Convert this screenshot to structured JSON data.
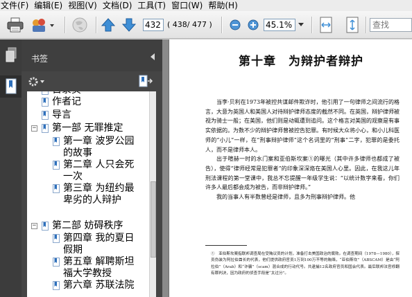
{
  "menu": [
    "文件(F)",
    "编辑(E)",
    "视图(V)",
    "文档(D)",
    "工具(T)",
    "窗口(W)",
    "帮助(H)"
  ],
  "toolbar": {
    "page_number": "432",
    "page_count": "( 438/ 477 )",
    "zoom": "45.1%",
    "search_placeholder": "查找"
  },
  "panel": {
    "title": "书签"
  },
  "bookmarks": [
    {
      "label": "日录页",
      "level": 0
    },
    {
      "label": "作者记",
      "level": 0
    },
    {
      "label": "导言",
      "level": 0
    },
    {
      "label": "第一部 无罪推定",
      "level": 0,
      "toggle": "−"
    },
    {
      "label": "第一章 波罗公园的故事",
      "level": 1
    },
    {
      "label": "第二章 人只会死一次",
      "level": 1
    },
    {
      "label": "第三章 为纽约最卑劣的人辩护",
      "level": 1
    },
    {
      "label": "第二部 妨碍秩序",
      "level": 0,
      "toggle": "−"
    },
    {
      "label": "第四章 我的夏日假期",
      "level": 1
    },
    {
      "label": "第五章 解聘斯坦福大学教授",
      "level": 1
    },
    {
      "label": "第六章 苏联法院",
      "level": 1
    }
  ],
  "document": {
    "chapter_title": "第十章　为辩护者辩护",
    "paragraphs": [
      "当李·贝利在1973年被控共谋邮件欺诈时，他引用了一句律师之间流行的格言，大意为英国人和美国人对待辩护律师态度的截然不同。在英国，辩护律师被视为骑士一般；在美国，他们则是动辄遭到追问。这个格言对美国的观察是有事实依据的。为数不少的辩护律师曾被控告犯罪。有时候大众将小心，和小儿科医师的“小儿”一样，在“刑事辩护律师”这个名词里的“刑事”二字，犯罪的是委托人，而不是律师本人。",
      "出于暄赫一时的水门案和亚伯斯坎案①的曝光（其中许多律师也都成了被告），使得“律师经常是犯罪者”的印象深深烙在美国人心里。因此，在我这儿年刑法课程的第一堂课中，我总不忘提醒一年级学生说：“以统计数字来看，你们许多人最后都会成为被告，而非辩护律师。”",
      "我的当事人有半数曾经是律师，且多为刑事辩护律师。他"
    ],
    "footnote": "①　亚伯斯坎案指联邦调查局在受贿议员的计划，准备打击美国政治的腐败。在调查期间（1978—1980），探员伪装为阿拉伯酋长的代表，他们提供政府官员1万到100万不等的贿赂，“亚伯斯坎”（ABSCAM）是由“阿拉伯”（Arab）和“诈骗”（scam）混合成的行动代号。共逮捕12名政府官员和国会代表。最后联邦法官修翻有罪判决，因为政府的侦查手段是“太过分”。"
  }
}
